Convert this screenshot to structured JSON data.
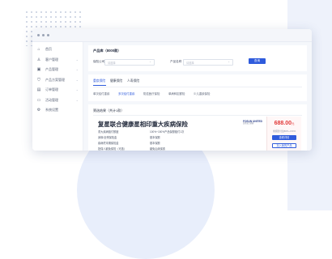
{
  "sidebar": {
    "items": [
      {
        "icon": "home-icon",
        "glyph": "⌂",
        "label": "首页"
      },
      {
        "icon": "user-icon",
        "glyph": "♙",
        "label": "客户管理"
      },
      {
        "icon": "box-icon",
        "glyph": "▣",
        "label": "产品管理"
      },
      {
        "icon": "shield-icon",
        "glyph": "⛉",
        "label": "产品方案管理"
      },
      {
        "icon": "document-icon",
        "glyph": "▤",
        "label": "订单管理"
      },
      {
        "icon": "calendar-icon",
        "glyph": "▭",
        "label": "活动管理"
      },
      {
        "icon": "settings-icon",
        "glyph": "⚙",
        "label": "系统设置"
      }
    ]
  },
  "filter": {
    "section_title": "产品库（8000款）",
    "field1_label": "保险公司",
    "field1_placeholder": "请选择",
    "field2_label": "产品名称",
    "field2_placeholder": "请选择",
    "search_label": "查询"
  },
  "tabs": {
    "main": [
      "重疾保险",
      "健康保险",
      "人寿保险"
    ],
    "sub": [
      "单次给付重疾",
      "多次给付重疾",
      "防癌医疗保险",
      "单病种定额险",
      "少儿重疾保险"
    ]
  },
  "results": {
    "title": "筛选结果（共计1款）",
    "product": {
      "name": "复星联合健康星相印重大疾病保险",
      "logo_text": "FOSUN UNITED",
      "logo_sub": "复星联合健康",
      "details_left": [
        "重大疾病赔付额度",
        "身故/全残保险金",
        "疾病终末期保险金",
        "投保人豁免保险（可选）"
      ],
      "details_right": [
        "100%~150%产品保额赔付1次",
        "基本保额",
        "基本保额",
        "豁免后续保费"
      ],
      "price": "688.00",
      "price_unit": "元",
      "price_note": "重疾赔付达80%~150%",
      "detail_button": "查看详情",
      "compare_button": "加入我的产品"
    }
  }
}
